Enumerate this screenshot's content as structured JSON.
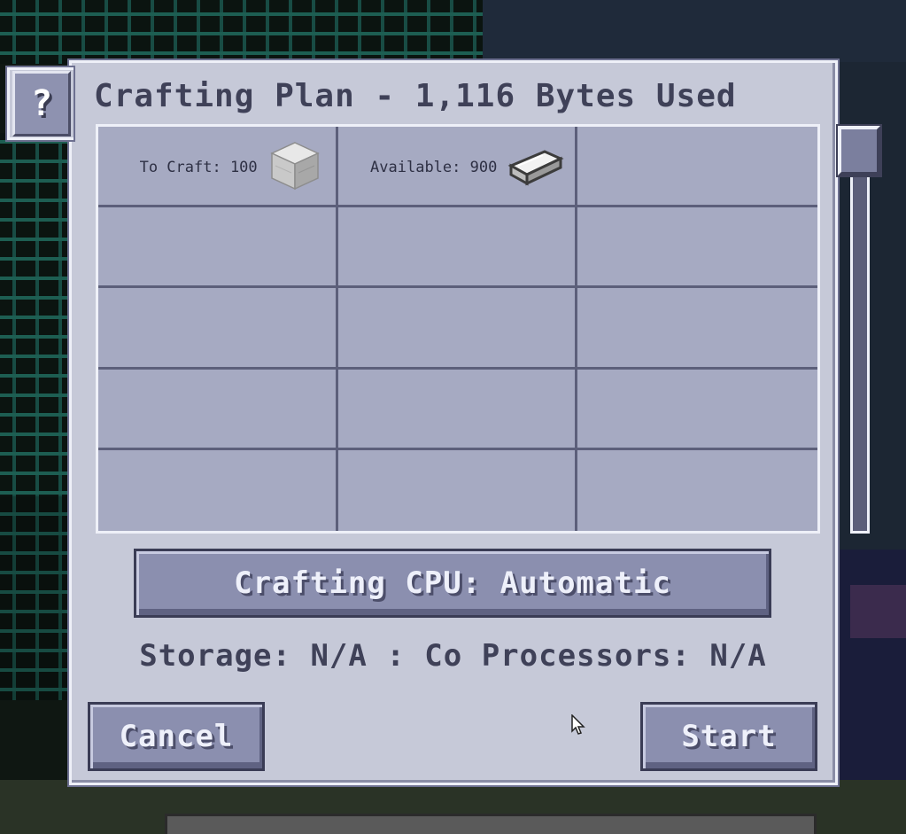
{
  "window": {
    "title": "Crafting Plan - 1,116 Bytes Used",
    "help_label": "?"
  },
  "grid": {
    "cells": [
      {
        "label": "To Craft: 100",
        "item": "iron-block-icon"
      },
      {
        "label": "Available: 900",
        "item": "iron-ingot-icon"
      },
      {
        "label": "",
        "item": ""
      },
      {
        "label": "",
        "item": ""
      },
      {
        "label": "",
        "item": ""
      },
      {
        "label": "",
        "item": ""
      },
      {
        "label": "",
        "item": ""
      },
      {
        "label": "",
        "item": ""
      },
      {
        "label": "",
        "item": ""
      },
      {
        "label": "",
        "item": ""
      },
      {
        "label": "",
        "item": ""
      },
      {
        "label": "",
        "item": ""
      },
      {
        "label": "",
        "item": ""
      },
      {
        "label": "",
        "item": ""
      },
      {
        "label": "",
        "item": ""
      }
    ]
  },
  "cpu_button": {
    "label": "Crafting CPU: Automatic"
  },
  "status": {
    "storage_text": "Storage: N/A : Co Processors: N/A"
  },
  "actions": {
    "cancel_label": "Cancel",
    "start_label": "Start"
  },
  "colors": {
    "panel": "#c6c9d8",
    "grid_cell": "#a6aac2",
    "button": "#8b8faf",
    "text": "#3f4158"
  }
}
